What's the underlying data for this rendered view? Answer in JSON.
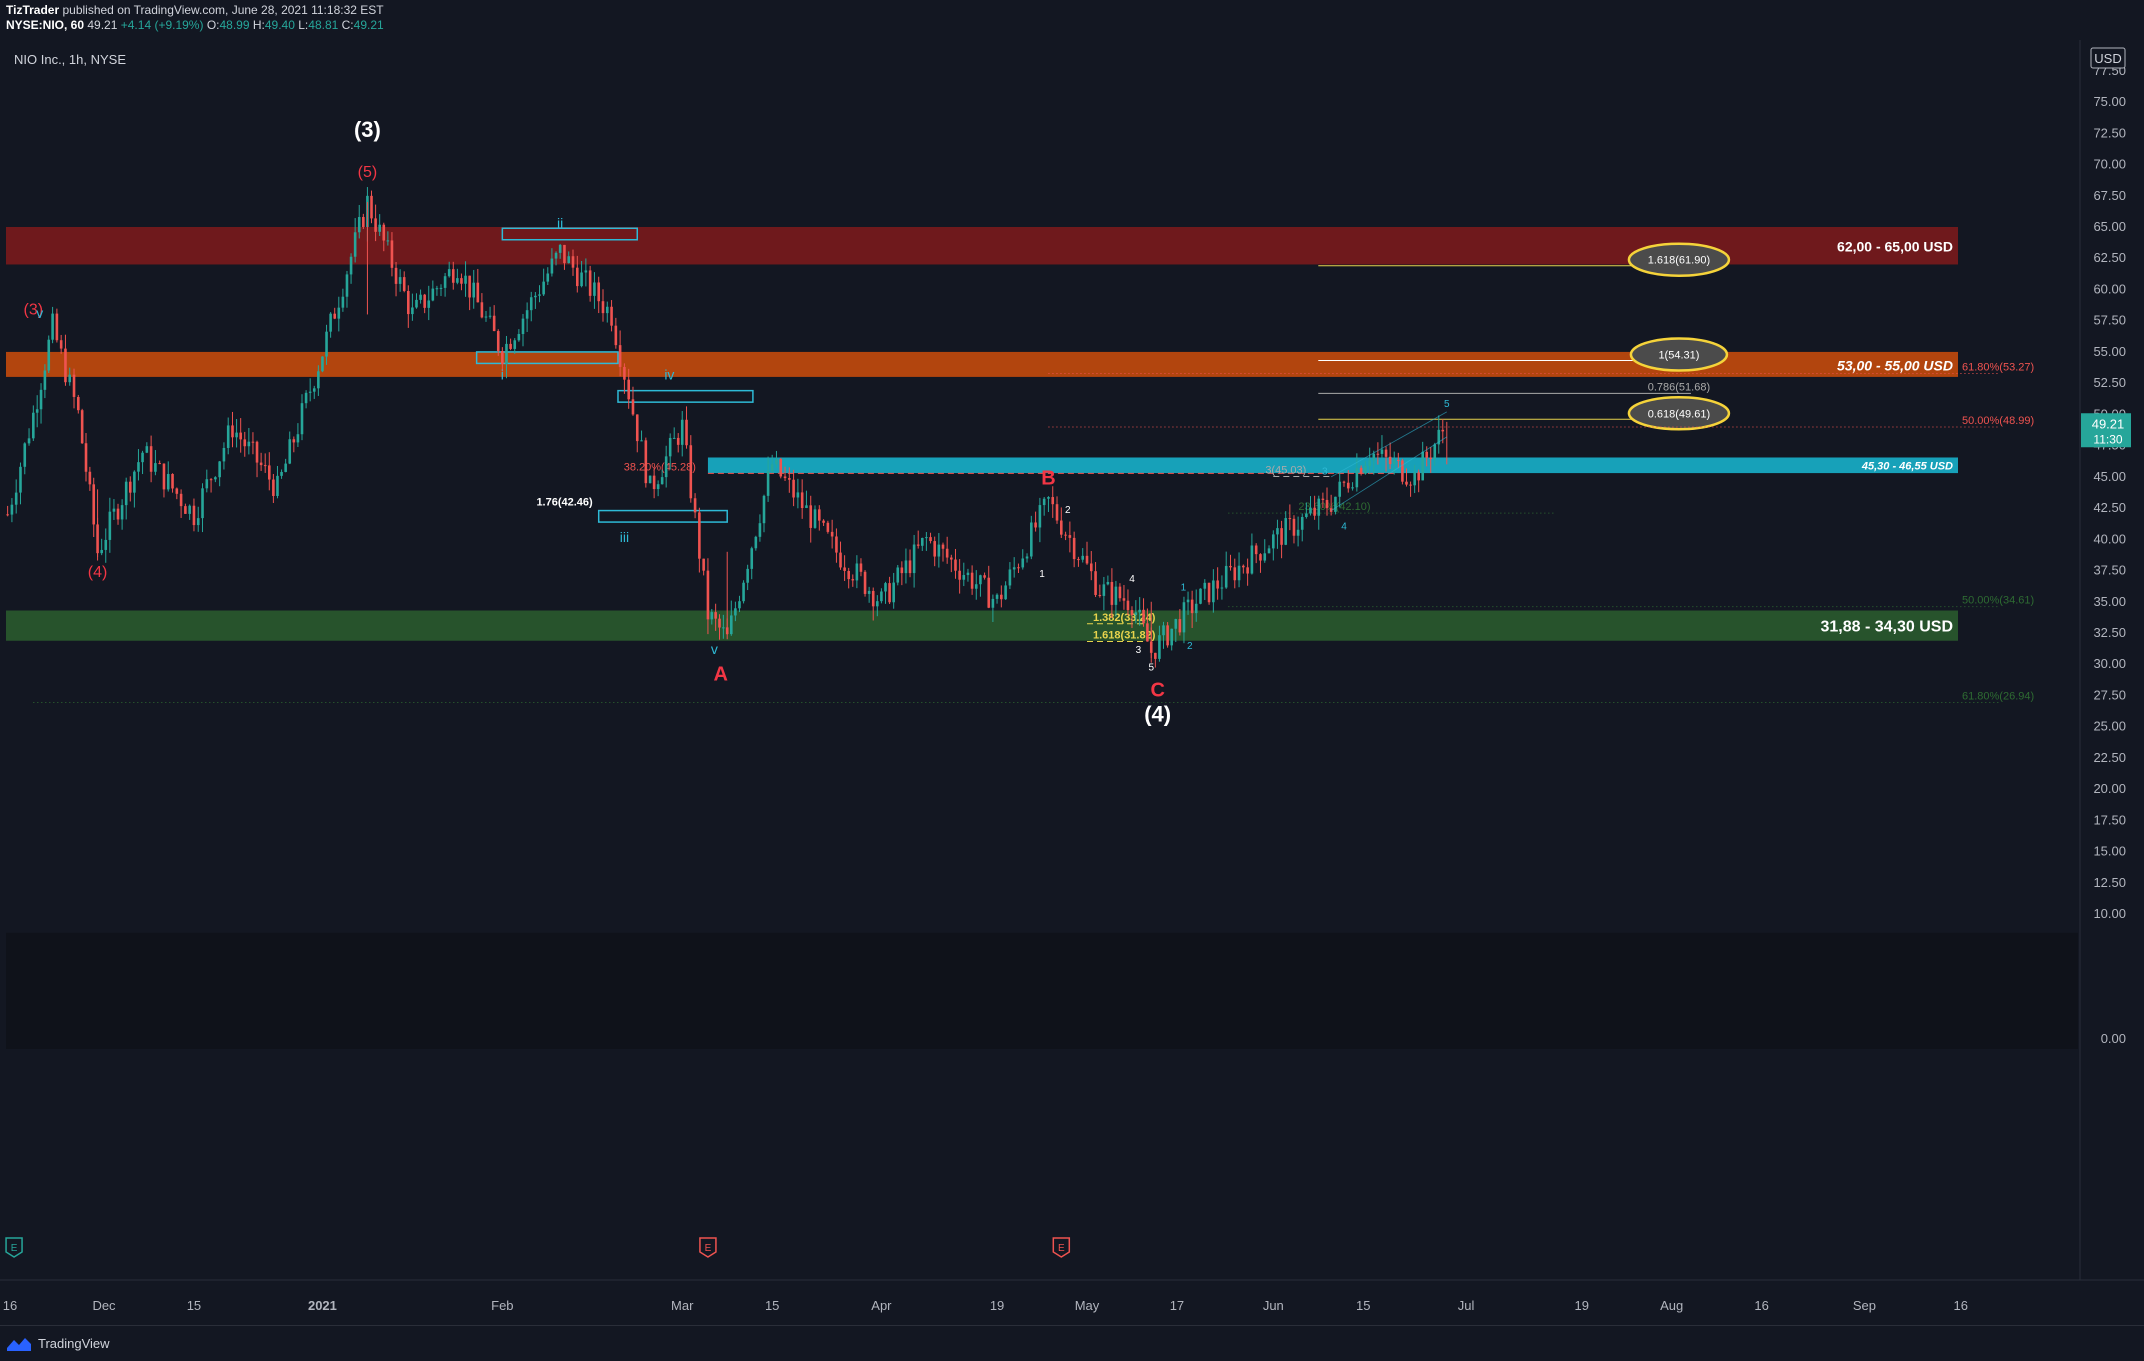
{
  "header": {
    "publisher": "TizTrader",
    "published_text": "published on TradingView.com, June 28, 2021 11:18:32 EST",
    "symbol": "NYSE:NIO, 60",
    "last": "49.21",
    "change": "+4.14 (+9.19%)",
    "o_label": "O:",
    "o": "48.99",
    "h_label": "H:",
    "h": "49.40",
    "l_label": "L:",
    "l": "48.81",
    "c_label": "C:",
    "c": "49.21"
  },
  "chart_title": "NIO Inc., 1h, NYSE",
  "currency": "USD",
  "footer": {
    "brand": "TradingView"
  },
  "colors": {
    "background": "#131722",
    "up": "#26a69a",
    "down": "#ef5350",
    "red_zone": "#7a1a1c",
    "orange_zone": "#c44a0c",
    "green_zone": "#2a5a2d",
    "cyan_zone": "#17a9c2",
    "wave_red": "#f23645",
    "wave_cyan": "#2ebad6",
    "fib_yellow": "#e8d44d"
  },
  "chart_data": {
    "type": "candlestick",
    "title": "NIO Inc., 1h, NYSE",
    "xlabel": "",
    "ylabel": "",
    "y_axis": {
      "min": 0,
      "max": 80,
      "ticks": [
        {
          "v": 77.5,
          "t": "77.50"
        },
        {
          "v": 75,
          "t": "75.00"
        },
        {
          "v": 72.5,
          "t": "72.50"
        },
        {
          "v": 70,
          "t": "70.00"
        },
        {
          "v": 67.5,
          "t": "67.50"
        },
        {
          "v": 65,
          "t": "65.00"
        },
        {
          "v": 62.5,
          "t": "62.50"
        },
        {
          "v": 60,
          "t": "60.00"
        },
        {
          "v": 57.5,
          "t": "57.50"
        },
        {
          "v": 55,
          "t": "55.00"
        },
        {
          "v": 52.5,
          "t": "52.50"
        },
        {
          "v": 50,
          "t": "50.00"
        },
        {
          "v": 47.5,
          "t": "47.50"
        },
        {
          "v": 45,
          "t": "45.00"
        },
        {
          "v": 42.5,
          "t": "42.50"
        },
        {
          "v": 40,
          "t": "40.00"
        },
        {
          "v": 37.5,
          "t": "37.50"
        },
        {
          "v": 35,
          "t": "35.00"
        },
        {
          "v": 32.5,
          "t": "32.50"
        },
        {
          "v": 30,
          "t": "30.00"
        },
        {
          "v": 27.5,
          "t": "27.50"
        },
        {
          "v": 25,
          "t": "25.00"
        },
        {
          "v": 22.5,
          "t": "22.50"
        },
        {
          "v": 20,
          "t": "20.00"
        },
        {
          "v": 17.5,
          "t": "17.50"
        },
        {
          "v": 15,
          "t": "15.00"
        },
        {
          "v": 12.5,
          "t": "12.50"
        },
        {
          "v": 10,
          "t": "10.00"
        },
        {
          "v": 0,
          "t": "0.00"
        }
      ]
    },
    "x_axis": {
      "ticks": [
        {
          "d": "2020-11-16",
          "t": "16"
        },
        {
          "d": "2020-12-01",
          "t": "Dec"
        },
        {
          "d": "2020-12-15",
          "t": "15"
        },
        {
          "d": "2021-01-04",
          "t": "2021"
        },
        {
          "d": "2021-02-01",
          "t": "Feb"
        },
        {
          "d": "2021-03-01",
          "t": "Mar"
        },
        {
          "d": "2021-03-15",
          "t": "15"
        },
        {
          "d": "2021-04-01",
          "t": "Apr"
        },
        {
          "d": "2021-04-19",
          "t": "19"
        },
        {
          "d": "2021-05-03",
          "t": "May"
        },
        {
          "d": "2021-05-17",
          "t": "17"
        },
        {
          "d": "2021-06-01",
          "t": "Jun"
        },
        {
          "d": "2021-06-15",
          "t": "15"
        },
        {
          "d": "2021-07-01",
          "t": "Jul"
        },
        {
          "d": "2021-07-19",
          "t": "19"
        },
        {
          "d": "2021-08-02",
          "t": "Aug"
        },
        {
          "d": "2021-08-16",
          "t": "16"
        },
        {
          "d": "2021-09-01",
          "t": "Sep"
        },
        {
          "d": "2021-09-16",
          "t": "16"
        }
      ]
    },
    "price_path": [
      {
        "d": "2020-11-16",
        "p": 42
      },
      {
        "d": "2020-11-20",
        "p": 50
      },
      {
        "d": "2020-11-23",
        "p": 57
      },
      {
        "d": "2020-11-27",
        "p": 50
      },
      {
        "d": "2020-11-30",
        "p": 39
      },
      {
        "d": "2020-12-07",
        "p": 47
      },
      {
        "d": "2020-12-15",
        "p": 42
      },
      {
        "d": "2020-12-21",
        "p": 49
      },
      {
        "d": "2020-12-28",
        "p": 44
      },
      {
        "d": "2021-01-04",
        "p": 55
      },
      {
        "d": "2021-01-11",
        "p": 67
      },
      {
        "d": "2021-01-18",
        "p": 58
      },
      {
        "d": "2021-01-25",
        "p": 62
      },
      {
        "d": "2021-02-01",
        "p": 55
      },
      {
        "d": "2021-02-10",
        "p": 63
      },
      {
        "d": "2021-02-18",
        "p": 58
      },
      {
        "d": "2021-02-24",
        "p": 44
      },
      {
        "d": "2021-03-01",
        "p": 49
      },
      {
        "d": "2021-03-05",
        "p": 34
      },
      {
        "d": "2021-03-08",
        "p": 32
      },
      {
        "d": "2021-03-15",
        "p": 46
      },
      {
        "d": "2021-03-25",
        "p": 39
      },
      {
        "d": "2021-04-01",
        "p": 35
      },
      {
        "d": "2021-04-08",
        "p": 40
      },
      {
        "d": "2021-04-19",
        "p": 35
      },
      {
        "d": "2021-04-27",
        "p": 43
      },
      {
        "d": "2021-05-05",
        "p": 36
      },
      {
        "d": "2021-05-10",
        "p": 35
      },
      {
        "d": "2021-05-13",
        "p": 31
      },
      {
        "d": "2021-05-20",
        "p": 35
      },
      {
        "d": "2021-06-01",
        "p": 40
      },
      {
        "d": "2021-06-10",
        "p": 43
      },
      {
        "d": "2021-06-16",
        "p": 47
      },
      {
        "d": "2021-06-23",
        "p": 45
      },
      {
        "d": "2021-06-28",
        "p": 49.21
      }
    ],
    "zones": [
      {
        "name": "red-resistance-zone",
        "from": 62,
        "to": 65,
        "label": "62,00 - 65,00 USD",
        "color": "#7a1a1c"
      },
      {
        "name": "orange-resistance-zone",
        "from": 53,
        "to": 55,
        "label": "53,00 - 55,00 USD",
        "color": "#c44a0c"
      },
      {
        "name": "cyan-support-zone",
        "from": 45.3,
        "to": 46.55,
        "label": "45,30 - 46,55 USD",
        "color": "#17a9c2",
        "start": "2021-03-05"
      },
      {
        "name": "green-support-zone",
        "from": 31.88,
        "to": 34.3,
        "label": "31,88 - 34,30 USD",
        "color": "#2a5a2d"
      }
    ],
    "fib_levels": [
      {
        "y": 61.9,
        "label": "1.618(61.90)",
        "color": "#e8d44d",
        "start": "2021-06-08",
        "end": "2021-08-05",
        "circled": true
      },
      {
        "y": 54.31,
        "label": "1(54.31)",
        "color": "#ffffff",
        "start": "2021-06-08",
        "end": "2021-08-05",
        "circled": true
      },
      {
        "y": 51.68,
        "label": "0.786(51.68)",
        "color": "#aaaaaa",
        "start": "2021-06-08",
        "end": "2021-08-05",
        "circled": false
      },
      {
        "y": 49.61,
        "label": "0.618(49.61)",
        "color": "#e8d44d",
        "start": "2021-06-08",
        "end": "2021-08-05",
        "circled": true
      },
      {
        "y": 53.27,
        "label": "61.80%(53.27)",
        "color": "#ef5350",
        "start": "2021-04-27",
        "end": "2021-09-22",
        "dotted": true
      },
      {
        "y": 48.99,
        "label": "50.00%(48.99)",
        "color": "#ef5350",
        "start": "2021-04-27",
        "end": "2021-09-22",
        "dotted": true
      },
      {
        "y": 45.28,
        "label": "38.20%(45.28)",
        "color": "#ef5350",
        "start": "2021-03-05",
        "end": "2021-06-20",
        "dashed": true
      },
      {
        "y": 45.03,
        "label": "3(45.03)",
        "color": "#aaaaaa",
        "start": "2021-06-01",
        "end": "2021-06-10",
        "dashed": true
      },
      {
        "y": 42.1,
        "label": "23.60%(42.10)",
        "color": "#2e6b32",
        "start": "2021-05-25",
        "end": "2021-07-15",
        "dotted": true
      },
      {
        "y": 34.61,
        "label": "50.00%(34.61)",
        "color": "#2e6b32",
        "start": "2021-05-25",
        "end": "2021-09-22",
        "dotted": true
      },
      {
        "y": 26.94,
        "label": "61.80%(26.94)",
        "color": "#2e6b32",
        "start": "2020-11-20",
        "end": "2021-09-22",
        "dotted": true
      },
      {
        "y": 33.24,
        "label": "1.382(33.24)",
        "color": "#e8d44d",
        "start": "2021-05-03",
        "end": "2021-05-12",
        "dashed": true
      },
      {
        "y": 31.82,
        "label": "1.618(31.82)",
        "color": "#e8d44d",
        "start": "2021-05-03",
        "end": "2021-05-12",
        "dashed": true
      },
      {
        "y": 42.46,
        "label": "1.76(42.46)",
        "color": "#ffffff",
        "start": "2021-02-16",
        "end": "2021-02-20",
        "dashed": false
      }
    ],
    "wave_labels": [
      {
        "text": "(3)",
        "d": "2021-01-11",
        "y": 72.2,
        "color": "#ffffff",
        "size": "big"
      },
      {
        "text": "(5)",
        "d": "2021-01-11",
        "y": 69.0,
        "color": "#f23645",
        "size": "mid"
      },
      {
        "text": "(3)",
        "d": "2020-11-20",
        "y": 58.0,
        "color": "#f23645",
        "size": "mid"
      },
      {
        "text": "(4)",
        "d": "2020-11-30",
        "y": 37.0,
        "color": "#f23645",
        "size": "mid"
      },
      {
        "text": "v",
        "d": "2020-11-21",
        "y": 57.7,
        "color": "#2ebad6",
        "size": "small"
      },
      {
        "text": "ii",
        "d": "2021-02-10",
        "y": 64.9,
        "color": "#2ebad6",
        "size": "small"
      },
      {
        "text": "i",
        "d": "2021-02-01",
        "y": 52.8,
        "color": "#2ebad6",
        "size": "small"
      },
      {
        "text": "iv",
        "d": "2021-02-27",
        "y": 52.8,
        "color": "#2ebad6",
        "size": "small"
      },
      {
        "text": "iii",
        "d": "2021-02-20",
        "y": 39.8,
        "color": "#2ebad6",
        "size": "small"
      },
      {
        "text": "v",
        "d": "2021-03-06",
        "y": 30.8,
        "color": "#2ebad6",
        "size": "small"
      },
      {
        "text": "A",
        "d": "2021-03-07",
        "y": 28.7,
        "color": "#f23645",
        "size": "mid-bold"
      },
      {
        "text": "B",
        "d": "2021-04-27",
        "y": 44.4,
        "color": "#f23645",
        "size": "mid-bold"
      },
      {
        "text": "C",
        "d": "2021-05-14",
        "y": 27.4,
        "color": "#f23645",
        "size": "mid-bold"
      },
      {
        "text": "(4)",
        "d": "2021-05-14",
        "y": 25.4,
        "color": "#ffffff",
        "size": "big"
      },
      {
        "text": "1",
        "d": "2021-04-26",
        "y": 37.0,
        "color": "#ffffff",
        "size": "tiny"
      },
      {
        "text": "2",
        "d": "2021-04-30",
        "y": 42.1,
        "color": "#ffffff",
        "size": "tiny"
      },
      {
        "text": "3",
        "d": "2021-05-11",
        "y": 30.9,
        "color": "#ffffff",
        "size": "tiny"
      },
      {
        "text": "4",
        "d": "2021-05-10",
        "y": 36.6,
        "color": "#ffffff",
        "size": "tiny"
      },
      {
        "text": "5",
        "d": "2021-05-13",
        "y": 29.5,
        "color": "#ffffff",
        "size": "tiny"
      },
      {
        "text": "1",
        "d": "2021-05-18",
        "y": 35.9,
        "color": "#2ebad6",
        "size": "tiny"
      },
      {
        "text": "2",
        "d": "2021-05-19",
        "y": 31.2,
        "color": "#2ebad6",
        "size": "tiny"
      },
      {
        "text": "3",
        "d": "2021-06-09",
        "y": 45.2,
        "color": "#2ebad6",
        "size": "tiny"
      },
      {
        "text": "4",
        "d": "2021-06-12",
        "y": 40.8,
        "color": "#2ebad6",
        "size": "tiny"
      },
      {
        "text": "5",
        "d": "2021-06-28",
        "y": 50.6,
        "color": "#2ebad6",
        "size": "tiny"
      }
    ],
    "wave_boxes": [
      {
        "start": "2021-02-01",
        "end": "2021-02-22",
        "top": 64.9,
        "bottom": 64.3
      },
      {
        "start": "2021-01-28",
        "end": "2021-02-19",
        "top": 55.0,
        "bottom": 54.4
      },
      {
        "start": "2021-02-19",
        "end": "2021-03-12",
        "top": 51.9,
        "bottom": 51.3
      },
      {
        "start": "2021-02-16",
        "end": "2021-03-08",
        "top": 42.3,
        "bottom": 41.7
      }
    ],
    "events": [
      {
        "d": "2020-11-17",
        "label": "E",
        "color": "#26a69a"
      },
      {
        "d": "2021-03-05",
        "label": "E",
        "color": "#ef5350"
      },
      {
        "d": "2021-04-29",
        "label": "E",
        "color": "#ef5350"
      }
    ],
    "last_price": {
      "value": 49.21,
      "label": "49.21",
      "countdown": "11:30"
    }
  }
}
